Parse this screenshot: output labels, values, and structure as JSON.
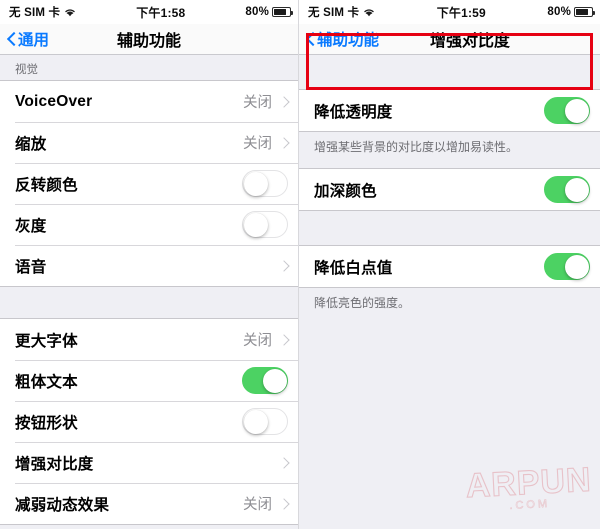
{
  "left": {
    "statusbar": {
      "carrier": "无 SIM 卡",
      "wifi_icon": "wifi-icon",
      "time": "下午1:58",
      "battery_percent": "80%",
      "battery_icon": "battery-icon"
    },
    "navbar": {
      "back_label": "通用",
      "back_icon": "chevron-left-icon",
      "title": "辅助功能"
    },
    "section_header": "视觉",
    "group1": [
      {
        "label": "VoiceOver",
        "value": "关闭",
        "accessory": "chevron"
      },
      {
        "label": "缩放",
        "value": "关闭",
        "accessory": "chevron"
      },
      {
        "label": "反转颜色",
        "value": "",
        "accessory": "switch",
        "switch_on": false
      },
      {
        "label": "灰度",
        "value": "",
        "accessory": "switch",
        "switch_on": false
      },
      {
        "label": "语音",
        "value": "",
        "accessory": "chevron"
      }
    ],
    "group2": [
      {
        "label": "更大字体",
        "value": "关闭",
        "accessory": "chevron"
      },
      {
        "label": "粗体文本",
        "value": "",
        "accessory": "switch",
        "switch_on": true
      },
      {
        "label": "按钮形状",
        "value": "",
        "accessory": "switch",
        "switch_on": false
      },
      {
        "label": "增强对比度",
        "value": "",
        "accessory": "chevron"
      },
      {
        "label": "减弱动态效果",
        "value": "关闭",
        "accessory": "chevron"
      }
    ]
  },
  "right": {
    "statusbar": {
      "carrier": "无 SIM 卡",
      "wifi_icon": "wifi-icon",
      "time": "下午1:59",
      "battery_percent": "80%",
      "battery_icon": "battery-icon"
    },
    "navbar": {
      "back_label": "辅助功能",
      "back_icon": "chevron-left-icon",
      "title": "增强对比度"
    },
    "group1": [
      {
        "label": "降低透明度",
        "accessory": "switch",
        "switch_on": true
      }
    ],
    "footnote1": "增强某些背景的对比度以增加易读性。",
    "group2": [
      {
        "label": "加深颜色",
        "accessory": "switch",
        "switch_on": true
      }
    ],
    "group3": [
      {
        "label": "降低白点值",
        "accessory": "switch",
        "switch_on": true
      }
    ],
    "footnote2": "降低亮色的强度。",
    "highlight": {
      "color": "#E60012",
      "target": "降低透明度"
    }
  },
  "watermark": {
    "main": "ARPUN",
    "sub": ".COM"
  },
  "colors": {
    "accent_blue": "#0A7AFF",
    "switch_green": "#4CD263",
    "background_gray": "#EFEFF4",
    "separator": "#C8C7CC",
    "secondary_text": "#8E8E93",
    "highlight_red": "#E60012"
  }
}
